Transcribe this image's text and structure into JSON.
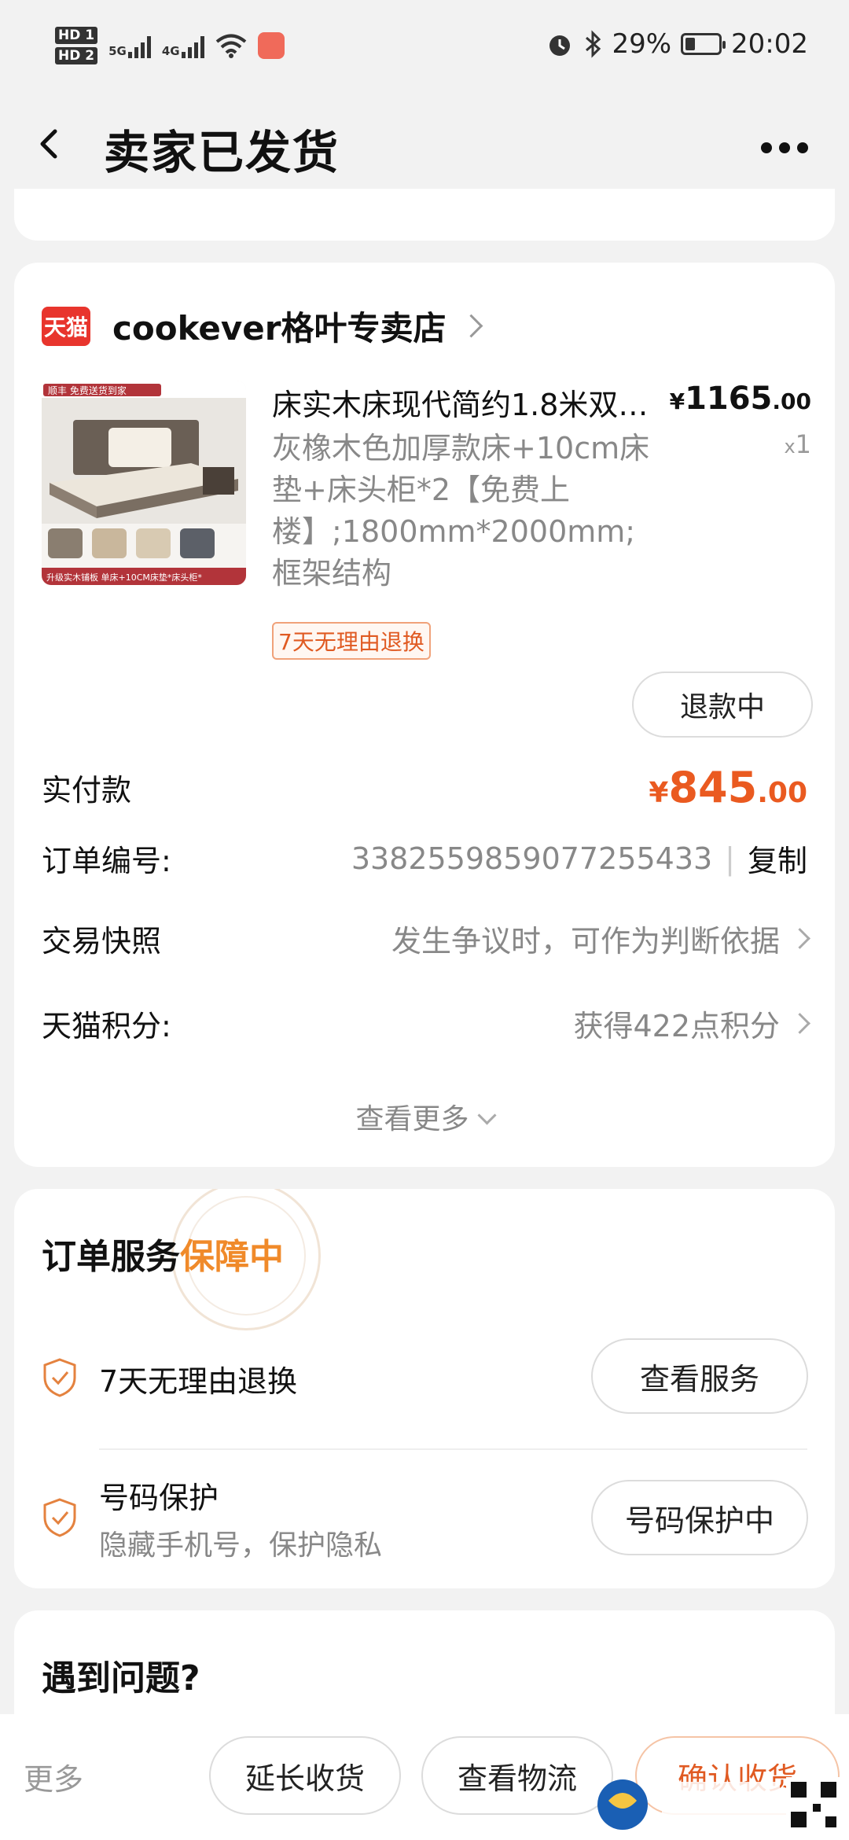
{
  "status_bar": {
    "sim1": "HD 1",
    "sim2": "HD 2",
    "net1": "5G",
    "net2": "4G",
    "battery": "29%",
    "time": "20:02"
  },
  "header": {
    "title": "卖家已发货"
  },
  "store": {
    "badge": "天猫",
    "name": "cookever格叶专卖店"
  },
  "product": {
    "title": "床实木床现代简约1.8米双…",
    "price_symbol": "¥",
    "price_int": "1165",
    "price_dec": ".00",
    "qty_x": "x",
    "qty": "1",
    "sku": "灰橡木色加厚款床+10cm床垫+床头柜*2【免费上楼】;1800mm*2000mm;框架结构",
    "tag": "7天无理由退换",
    "thumb_banner": "顺丰 免费送货到家",
    "thumb_footer": "升级实木铺板 单床+10CM床垫*床头柜*"
  },
  "actions": {
    "refund": "退款中"
  },
  "order_info": {
    "paid_label": "实付款",
    "paid_symbol": "¥",
    "paid_int": "845",
    "paid_dec": ".00",
    "order_no_label": "订单编号:",
    "order_no": "3382559859077255433",
    "copy": "复制",
    "snapshot_label": "交易快照",
    "snapshot_value": "发生争议时，可作为判断依据",
    "points_label": "天猫积分:",
    "points_value": "获得422点积分",
    "see_more": "查看更多"
  },
  "service": {
    "title": "订单服务",
    "title_accent": "保障中",
    "item1": "7天无理由退换",
    "item1_btn": "查看服务",
    "item2": "号码保护",
    "item2_sub": "隐藏手机号，保护隐私",
    "item2_btn": "号码保护中"
  },
  "problem": {
    "title": "遇到问题?"
  },
  "bottom_bar": {
    "more": "更多",
    "extend": "延长收货",
    "logistics": "查看物流",
    "confirm": "确认收货"
  },
  "colors": {
    "accent_orange": "#ea5a20",
    "tmall_red": "#e8352d",
    "guarantee_gold": "#f08a2a"
  }
}
